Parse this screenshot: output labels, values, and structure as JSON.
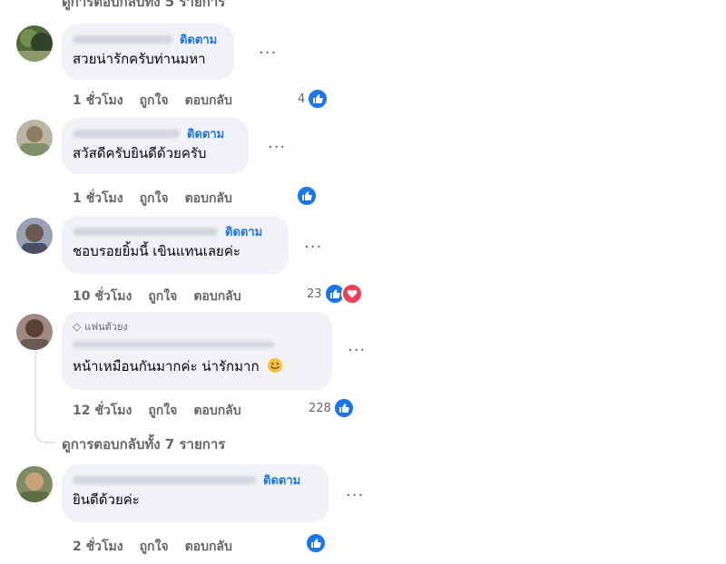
{
  "top_partial_text": "ดูการตอบกลับทั้ง 5 รายการ",
  "comments": [
    {
      "follow_label": "ติดตาม",
      "text": "สวยน่ารักครับท่านมหา",
      "time": "1 ชั่วโมง",
      "like_label": "ถูกใจ",
      "reply_label": "ตอบกลับ",
      "reaction_count": "4",
      "reactions": [
        "like-icon"
      ],
      "more": "···"
    },
    {
      "follow_label": "ติดตาม",
      "text": "สวัสดีครับยินดีด้วยครับ",
      "time": "1 ชั่วโมง",
      "like_label": "ถูกใจ",
      "reply_label": "ตอบกลับ",
      "reaction_count": "",
      "reactions": [
        "like-icon"
      ],
      "more": "···"
    },
    {
      "follow_label": "ติดตาม",
      "text": "ชอบรอยยิ้มนี้ เขินแทนเลยค่ะ",
      "time": "10 ชั่วโมง",
      "like_label": "ถูกใจ",
      "reply_label": "ตอบกลับ",
      "reaction_count": "23",
      "reactions": [
        "like-icon",
        "heart-icon"
      ],
      "more": "···"
    },
    {
      "fan_badge": "แฟนตัวยง",
      "text": "หน้าเหมือนกันมากค่ะ น่ารักมาก",
      "time": "12 ชั่วโมง",
      "like_label": "ถูกใจ",
      "reply_label": "ตอบกลับ",
      "reaction_count": "228",
      "reactions": [
        "like-icon"
      ],
      "more": "···"
    },
    {
      "follow_label": "ติดตาม",
      "text": "ยินดีด้วยค่ะ",
      "time": "2 ชั่วโมง",
      "like_label": "ถูกใจ",
      "reply_label": "ตอบกลับ",
      "reaction_count": "",
      "reactions": [
        "like-icon"
      ],
      "more": "···"
    }
  ],
  "view_replies": "ดูการตอบกลับทั้ง 7 รายการ",
  "colors": {
    "bubble": "#f0f2f5",
    "link": "#1876f2",
    "meta": "#65676b",
    "like": "#1876f2",
    "heart": "#f33e58"
  }
}
